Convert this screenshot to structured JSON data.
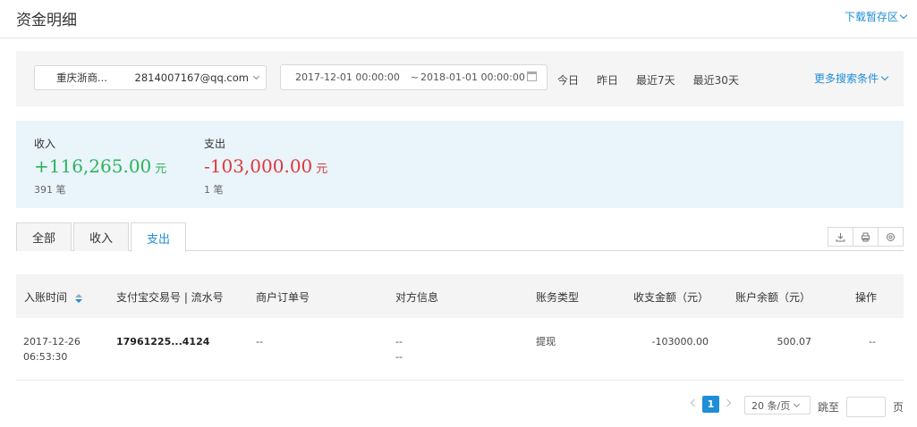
{
  "header": {
    "title": "资金明细",
    "download_link": "下载暂存区"
  },
  "search": {
    "account_name": "重庆浙商...",
    "account_email": "2814007167@qq.com",
    "date_from": "2017-12-01 00:00:00",
    "date_separator": "~",
    "date_to": "2018-01-01 00:00:00",
    "quick_dates": [
      "今日",
      "昨日",
      "最近7天",
      "最近30天"
    ],
    "more_filters": "更多搜索条件"
  },
  "summary": {
    "income": {
      "label": "收入",
      "amount": "+116,265.00",
      "unit": "元",
      "count": "391 笔",
      "color": "#2eb35a"
    },
    "expense": {
      "label": "支出",
      "amount": "-103,000.00",
      "unit": "元",
      "count": "1 笔",
      "color": "#e0383b"
    }
  },
  "tabs": [
    {
      "label": "全部",
      "active": false
    },
    {
      "label": "收入",
      "active": false
    },
    {
      "label": "支出",
      "active": true
    }
  ],
  "toolbar": [
    "download-icon",
    "print-icon",
    "settings-icon"
  ],
  "table": {
    "columns": [
      "入账时间",
      "支付宝交易号 | 流水号",
      "商户订单号",
      "对方信息",
      "账务类型",
      "收支金额（元）",
      "账户余额（元）",
      "操作"
    ],
    "rows": [
      {
        "date": "2017-12-26",
        "time": "06:53:30",
        "trade_no": "17961225...4124",
        "order_no": "--",
        "counterparty_1": "--",
        "counterparty_2": "--",
        "type": "提现",
        "amount": "-103000.00",
        "balance": "500.07",
        "action": "--"
      }
    ]
  },
  "pagination": {
    "current_page": "1",
    "page_size": "20 条/页",
    "jump_label": "跳至",
    "jump_value": "",
    "page_unit": "页"
  },
  "colors": {
    "accent": "#1f8ed8",
    "income": "#2eb35a",
    "expense": "#e0383b",
    "summary_bg": "#e9f4fb"
  }
}
